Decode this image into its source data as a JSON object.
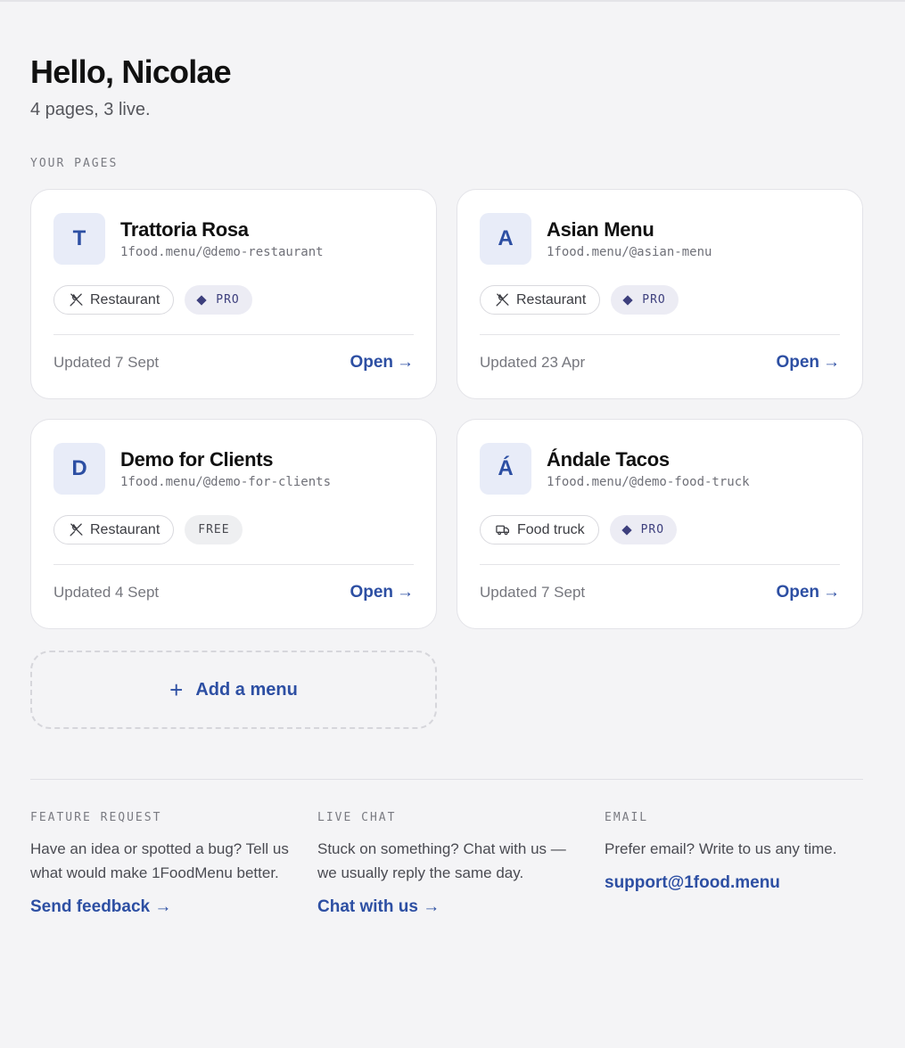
{
  "header": {
    "greeting": "Hello, Nicolae",
    "summary": "4 pages, 3 live."
  },
  "pages_section": {
    "label": "YOUR PAGES",
    "cards": [
      {
        "initial": "T",
        "title": "Trattoria Rosa",
        "url": "1food.menu/@demo-restaurant",
        "type_label": "Restaurant",
        "type_icon": "utensils-icon",
        "plan": "PRO",
        "updated": "Updated 7 Sept",
        "open_label": "Open",
        "open_arrow": "→"
      },
      {
        "initial": "A",
        "title": "Asian Menu",
        "url": "1food.menu/@asian-menu",
        "type_label": "Restaurant",
        "type_icon": "utensils-icon",
        "plan": "PRO",
        "updated": "Updated 23 Apr",
        "open_label": "Open",
        "open_arrow": "→"
      },
      {
        "initial": "D",
        "title": "Demo for Clients",
        "url": "1food.menu/@demo-for-clients",
        "type_label": "Restaurant",
        "type_icon": "utensils-icon",
        "plan": "FREE",
        "updated": "Updated 4 Sept",
        "open_label": "Open",
        "open_arrow": "→"
      },
      {
        "initial": "Á",
        "title": "Ándale Tacos",
        "url": "1food.menu/@demo-food-truck",
        "type_label": "Food truck",
        "type_icon": "truck-icon",
        "plan": "PRO",
        "updated": "Updated 7 Sept",
        "open_label": "Open",
        "open_arrow": "→"
      }
    ],
    "add_button": {
      "plus": "+",
      "label": "Add a menu"
    }
  },
  "help": [
    {
      "label": "FEATURE REQUEST",
      "text": "Have an idea or spotted a bug? Tell us what would make 1FoodMenu better.",
      "link": "Send feedback →"
    },
    {
      "label": "LIVE CHAT",
      "text": "Stuck on something? Chat with us — we usually reply the same day.",
      "link": "Chat with us →"
    },
    {
      "label": "EMAIL",
      "text": "Prefer email? Write to us any time.",
      "link": "support@1food.menu"
    }
  ],
  "colors": {
    "accent": "#2d4fa3",
    "background": "#f4f4f6",
    "pro_badge": "#ececf4"
  }
}
